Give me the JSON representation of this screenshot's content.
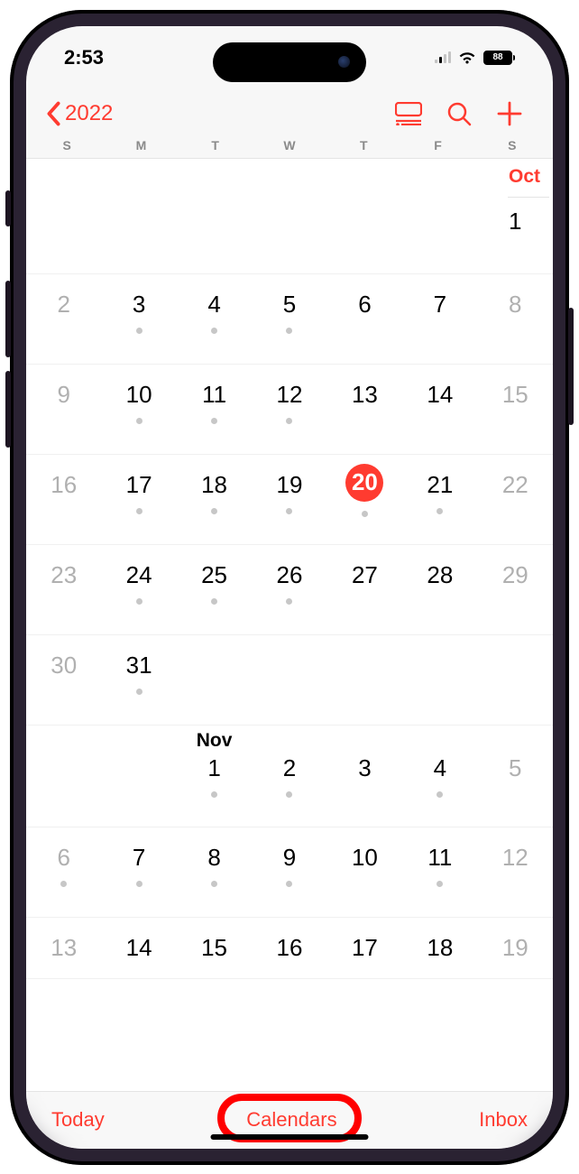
{
  "status": {
    "time": "2:53",
    "battery": "88"
  },
  "nav": {
    "year": "2022"
  },
  "dayhead": [
    "S",
    "M",
    "T",
    "W",
    "T",
    "F",
    "S"
  ],
  "months": {
    "oct": "Oct",
    "nov": "Nov"
  },
  "weeks": [
    {
      "class": "short",
      "cells": [
        {
          "n": "",
          "dim": false
        },
        {
          "n": "",
          "dim": false
        },
        {
          "n": "",
          "dim": false
        },
        {
          "n": "",
          "dim": false
        },
        {
          "n": "",
          "dim": false
        },
        {
          "n": "",
          "dim": false
        },
        {
          "n": "1",
          "dim": false,
          "monthLabel": "oct",
          "labelRed": true,
          "line": true
        }
      ]
    },
    {
      "class": "",
      "cells": [
        {
          "n": "2",
          "dim": true
        },
        {
          "n": "3",
          "dot": true
        },
        {
          "n": "4",
          "dot": true
        },
        {
          "n": "5",
          "dot": true
        },
        {
          "n": "6"
        },
        {
          "n": "7"
        },
        {
          "n": "8",
          "dim": true
        }
      ]
    },
    {
      "class": "",
      "cells": [
        {
          "n": "9",
          "dim": true
        },
        {
          "n": "10",
          "dot": true
        },
        {
          "n": "11",
          "dot": true
        },
        {
          "n": "12",
          "dot": true
        },
        {
          "n": "13"
        },
        {
          "n": "14"
        },
        {
          "n": "15",
          "dim": true
        }
      ]
    },
    {
      "class": "",
      "cells": [
        {
          "n": "16",
          "dim": true
        },
        {
          "n": "17",
          "dot": true
        },
        {
          "n": "18",
          "dot": true
        },
        {
          "n": "19",
          "dot": true
        },
        {
          "n": "20",
          "today": true,
          "dot": true
        },
        {
          "n": "21",
          "dot": true
        },
        {
          "n": "22",
          "dim": true
        }
      ]
    },
    {
      "class": "",
      "cells": [
        {
          "n": "23",
          "dim": true
        },
        {
          "n": "24",
          "dot": true
        },
        {
          "n": "25",
          "dot": true
        },
        {
          "n": "26",
          "dot": true
        },
        {
          "n": "27"
        },
        {
          "n": "28"
        },
        {
          "n": "29",
          "dim": true
        }
      ]
    },
    {
      "class": "",
      "cells": [
        {
          "n": "30",
          "dim": true
        },
        {
          "n": "31",
          "dot": true
        },
        {
          "n": ""
        },
        {
          "n": ""
        },
        {
          "n": ""
        },
        {
          "n": ""
        },
        {
          "n": ""
        }
      ]
    },
    {
      "class": "month-start",
      "cells": [
        {
          "n": ""
        },
        {
          "n": ""
        },
        {
          "n": "1",
          "dot": true,
          "monthLabel": "nov"
        },
        {
          "n": "2",
          "dot": true
        },
        {
          "n": "3"
        },
        {
          "n": "4",
          "dot": true
        },
        {
          "n": "5",
          "dim": true
        }
      ]
    },
    {
      "class": "",
      "cells": [
        {
          "n": "6",
          "dim": true,
          "dot": true
        },
        {
          "n": "7",
          "dot": true
        },
        {
          "n": "8",
          "dot": true
        },
        {
          "n": "9",
          "dot": true
        },
        {
          "n": "10"
        },
        {
          "n": "11",
          "dot": true
        },
        {
          "n": "12",
          "dim": true
        }
      ]
    },
    {
      "class": "partial",
      "cells": [
        {
          "n": "13",
          "dim": true
        },
        {
          "n": "14"
        },
        {
          "n": "15"
        },
        {
          "n": "16"
        },
        {
          "n": "17"
        },
        {
          "n": "18"
        },
        {
          "n": "19",
          "dim": true
        }
      ]
    }
  ],
  "toolbar": {
    "today": "Today",
    "calendars": "Calendars",
    "inbox": "Inbox"
  }
}
